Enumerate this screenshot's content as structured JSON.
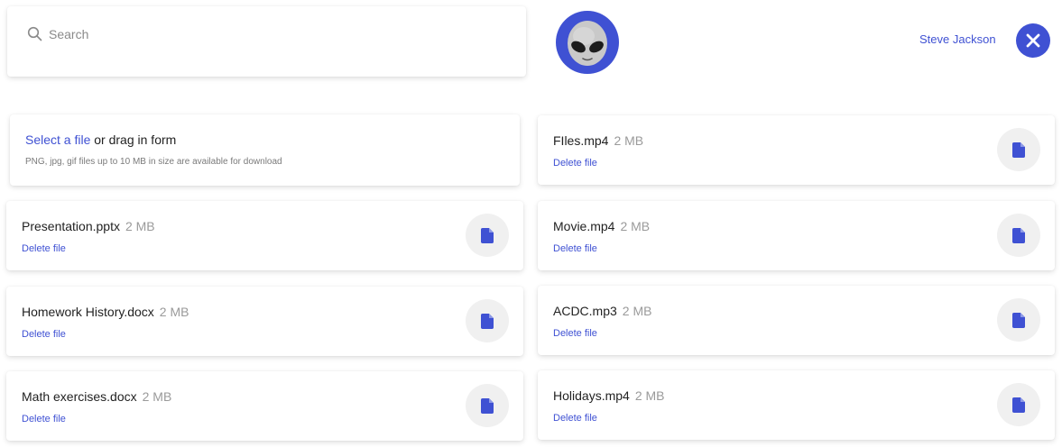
{
  "search": {
    "placeholder": "Search",
    "value": "",
    "icon": "search-icon"
  },
  "user": {
    "name": "Steve Jackson",
    "avatar": "alien-emoji",
    "close_icon": "close-icon"
  },
  "upload": {
    "select_link": "Select a file",
    "rest": " or drag in form",
    "hint": "PNG, jpg, gif files up to 10 MB in size are available for download"
  },
  "colors": {
    "accent": "#3f51d3",
    "button_bg": "#f0f0f0",
    "muted": "#9a9a9a"
  },
  "files_left": [
    {
      "name": "Presentation.pptx",
      "size": "2 MB",
      "delete": "Delete file",
      "icon": "document-icon"
    },
    {
      "name": "Homework History.docx",
      "size": "2 MB",
      "delete": "Delete file",
      "icon": "document-icon"
    },
    {
      "name": "Math exercises.docx",
      "size": "2 MB",
      "delete": "Delete file",
      "icon": "document-icon"
    }
  ],
  "files_right": [
    {
      "name": "FIles.mp4",
      "size": "2 MB",
      "delete": "Delete file",
      "icon": "document-icon"
    },
    {
      "name": "Movie.mp4",
      "size": "2 MB",
      "delete": "Delete file",
      "icon": "document-icon"
    },
    {
      "name": "ACDC.mp3",
      "size": "2 MB",
      "delete": "Delete file",
      "icon": "document-icon"
    },
    {
      "name": "Holidays.mp4",
      "size": "2 MB",
      "delete": "Delete file",
      "icon": "document-icon"
    }
  ]
}
